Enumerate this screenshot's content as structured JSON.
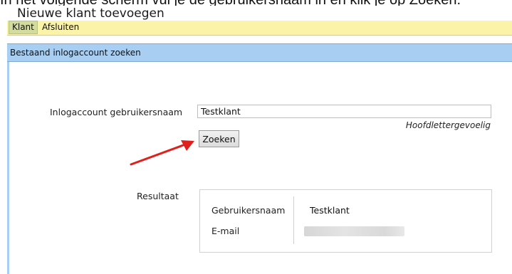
{
  "caption": "In het volgende scherm vul je de gebruikersnaam in en klik je op Zoeken.",
  "window": {
    "title": "Nieuwe klant toevoegen"
  },
  "menu": {
    "items": [
      {
        "label": "Klant"
      },
      {
        "label": "Afsluiten"
      }
    ]
  },
  "section": {
    "title": "Bestaand inlogaccount zoeken"
  },
  "form": {
    "username_label": "Inlogaccount gebruikersnaam",
    "username_value": "Testklant",
    "hint": "Hoofdlettergevoelig",
    "search_button": "Zoeken"
  },
  "result": {
    "label": "Resultaat",
    "rows": [
      {
        "key": "Gebruikersnaam",
        "value": "Testklant"
      },
      {
        "key": "E-mail",
        "value": ""
      }
    ]
  },
  "colors": {
    "menubar": "#fbf3a8",
    "section_bar": "#a8cef2",
    "arrow": "#e0201b"
  },
  "icons": {
    "annotation_arrow": "red-arrow-icon"
  }
}
